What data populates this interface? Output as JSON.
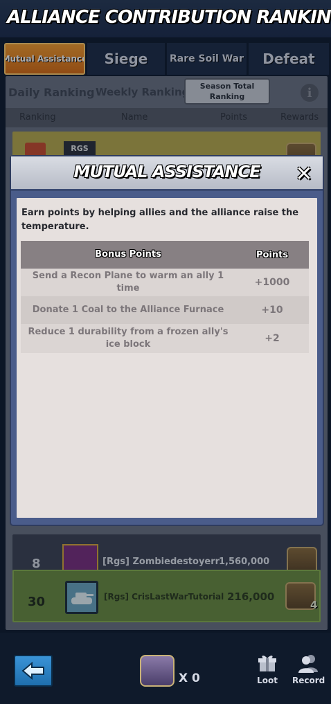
{
  "header": {
    "title": "ALLIANCE CONTRIBUTION RANKING"
  },
  "tabs": [
    {
      "label": "Mutual Assistance",
      "active": true
    },
    {
      "label": "Siege"
    },
    {
      "label": "Rare Soil War"
    },
    {
      "label": "Defeat"
    }
  ],
  "subtabs": {
    "daily": "Daily Ranking",
    "weekly": "Weekly Ranking",
    "season": "Season Total Ranking"
  },
  "columns": {
    "ranking": "Ranking",
    "name": "Name",
    "points": "Points",
    "rewards": "Rewards"
  },
  "background_rows": {
    "top_tag": "RGS",
    "row8": {
      "rank": "8",
      "name": "[Rgs] Zombiedestoyerr",
      "points": "1,560,000"
    },
    "my_row": {
      "rank": "30",
      "name": "[Rgs] CrisLastWarTutorial",
      "points": "216,000",
      "reward_count": "4"
    }
  },
  "modal": {
    "title": "MUTUAL ASSISTANCE",
    "close_icon": "close-icon",
    "description": "Earn points by helping allies and the alliance raise the temperature.",
    "table": {
      "headers": {
        "bonus": "Bonus Points",
        "points": "Points"
      },
      "rows": [
        {
          "action": "Send a Recon Plane to warm an ally 1 time",
          "points": "+1000"
        },
        {
          "action": "Donate 1 Coal to the Alliance Furnace",
          "points": "+10"
        },
        {
          "action": "Reduce 1 durability from a frozen ally's ice block",
          "points": "+2"
        }
      ]
    }
  },
  "bottom_bar": {
    "loot_count": "X 0",
    "loot_label": "Loot",
    "record_label": "Record"
  },
  "colors": {
    "active_tab": "#e57f1c",
    "modal_frame": "#4a5c8a",
    "my_row": "#6b8a3e"
  }
}
